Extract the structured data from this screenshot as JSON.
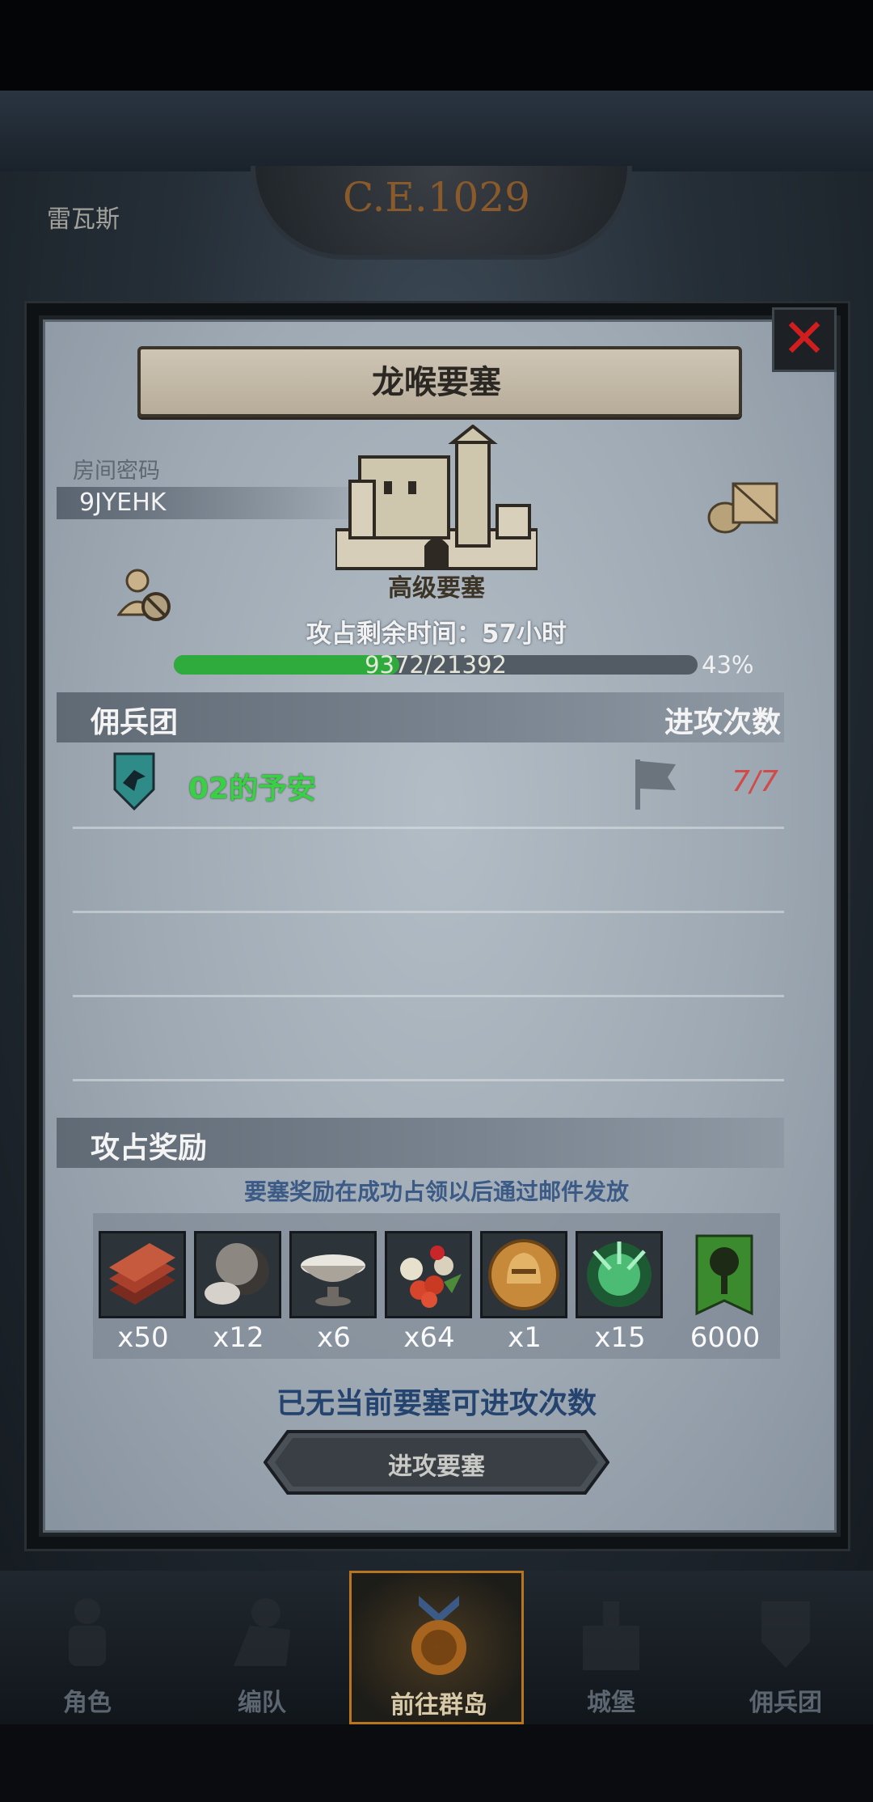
{
  "background": {
    "era": "C.E.1029",
    "region": "雷瓦斯"
  },
  "modal": {
    "title": "龙喉要塞",
    "close_icon": "close-x-icon",
    "room_label": "房间密码",
    "room_code": "9JYEHK",
    "fortress_level": "高级要塞",
    "time_left": "攻占剩余时间：57小时",
    "progress": {
      "current": 9372,
      "total": 21392,
      "text": "9372/21392",
      "percent_text": "43%",
      "fraction": 0.43
    },
    "mercenary_header": "佣兵团",
    "attacks_header": "进攻次数",
    "rows": [
      {
        "name": "02的予安",
        "count": "7/7",
        "icon": "shield-bird-icon",
        "status_icon": "flag-icon"
      }
    ],
    "reward_header": "攻占奖励",
    "reward_note": "要塞奖励在成功占领以后通过邮件发放",
    "rewards": [
      {
        "icon": "wood-planks-icon",
        "qty": "x50"
      },
      {
        "icon": "truffle-icon",
        "qty": "x12"
      },
      {
        "icon": "silver-bowl-icon",
        "qty": "x6"
      },
      {
        "icon": "berries-icon",
        "qty": "x64"
      },
      {
        "icon": "gold-helmet-coin-icon",
        "qty": "x1"
      },
      {
        "icon": "green-spirit-icon",
        "qty": "x15"
      },
      {
        "icon": "tree-banner-icon",
        "qty": "6000"
      }
    ],
    "no_attack_text": "已无当前要塞可进攻次数",
    "attack_button": "进攻要塞"
  },
  "nav": [
    {
      "label": "角色",
      "icon": "knight-icon"
    },
    {
      "label": "编队",
      "icon": "formation-icon"
    },
    {
      "label": "前往群岛",
      "icon": "islands-icon",
      "active": true
    },
    {
      "label": "城堡",
      "icon": "castle-icon"
    },
    {
      "label": "佣兵团",
      "icon": "mercenary-icon"
    }
  ],
  "colors": {
    "progress_fill": "#2faa3c",
    "attack_count": "#d14b4b",
    "mercenary_name": "#39d046",
    "note_blue": "#3c5a86"
  }
}
